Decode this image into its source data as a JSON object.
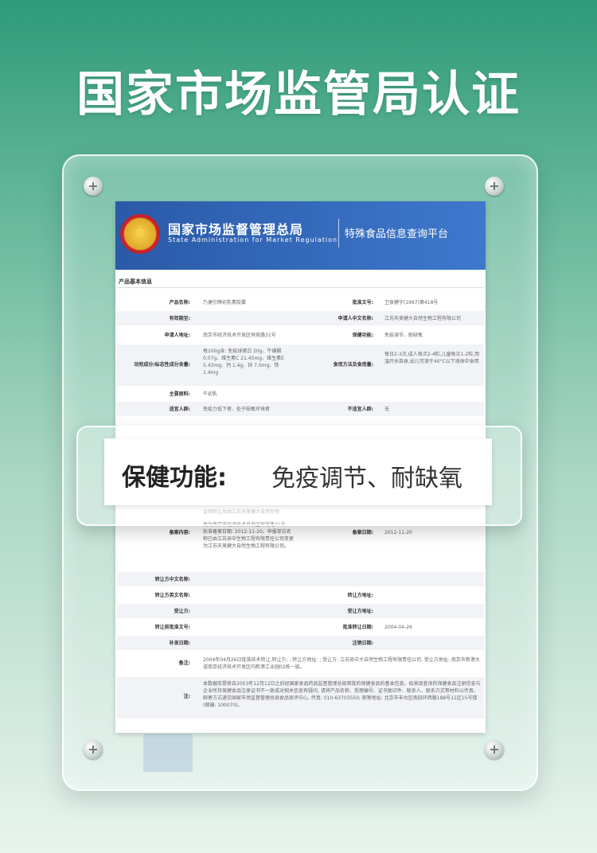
{
  "headline": "国家市场监管局认证",
  "doc": {
    "org_cn": "国家市场监督管理总局",
    "org_en": "State Administration for Market Regulation",
    "platform": "特殊食品信息查询平台",
    "section_title": "产品基本信息",
    "top_rows": [
      {
        "l1": "产品名称:",
        "v1": "乃捷尔牌初乳素胶囊",
        "l2": "批准文号:",
        "v2": "卫食健字(1997)第418号"
      },
      {
        "l1": "有效期至:",
        "v1": "",
        "l2": "申请人中文名称:",
        "v2": "江苏天美健大自然生物工程有限公司"
      },
      {
        "l1": "申请人地址:",
        "v1": "南京市经济技术开发区恒竞路31号",
        "l2": "保健功能:",
        "v2": "免疫调节、耐缺氧"
      },
      {
        "l1": "功效成分/标志性成分含量:",
        "v1": "每100g含: 免疫球蛋白 20g、牛磺酸 0.07g、维生素C 21.45mg、维生素E 5.43mg、钙 1.4g、锌 7.0mg、铁 1.4mg",
        "l2": "食用方法及食用量:",
        "v2": "每日2-3次,成人每次2-4粒,儿童每次1-2粒,用温开水吞食,幼儿可溶于40°C以下液体中食用"
      },
      {
        "l1": "主要原料:",
        "v1": "牛初乳",
        "l2": "",
        "v2": ""
      },
      {
        "l1": "适宜人群:",
        "v1": "免疫力低下者、处于缺氧环境者",
        "l2": "不适宜人群:",
        "v2": "无"
      }
    ],
    "partial_text": "证明转让后由江苏天美健大自然生物",
    "bottom_rows": [
      {
        "l1": "备案内容:",
        "v1": "更为南京市经济技术开发区恒竞路31号。 狄准备案日期: 2012-11-20。申报单位名称已由江苏吴中生物工程有限责任公司变更为江苏天美健大自然生物工程有限公司。",
        "l2": "备案日期:",
        "v2": "2012-11-20"
      },
      {
        "l1": "转让方中文名称:",
        "v1": "",
        "l2": "",
        "v2": ""
      },
      {
        "l1": "转让方英文名称:",
        "v1": "",
        "l2": "转让方地址:",
        "v2": ""
      },
      {
        "l1": "受让方:",
        "v1": "",
        "l2": "受让方地址:",
        "v2": ""
      },
      {
        "l1": "转让前批准文号:",
        "v1": "",
        "l2": "批准转让日期:",
        "v2": "2004-04-26"
      },
      {
        "l1": "补发日期:",
        "v1": "",
        "l2": "注销日期:",
        "v2": ""
      },
      {
        "l1": "备注:",
        "v1": "2004年04月26日批准技术转让,转让方: ; 转让方地址: ; 受让方: 江苏吴中大自然生物工程有限责任公司, 受让方地址: 南京市新港大道南京经济技术开发区内新港工业园02栋一层。",
        "l2": "",
        "v2": ""
      },
      {
        "l1": "注:",
        "v1": "本数据库提供自2003年12月12日之后经国家食品药品监督管理总局审批的保健食品的基本信息。如发现查询的保健食品注册信息与企业所持保健食品注册证书不一致或对相关信息有疑问, 请将产品名称、受理编号、证书复印件、联系人、联系方式等材料以传真、邮寄方式递交国家市场监督管理总局食品审评中心, 传真: 010-63703550; 邮寄地址: 北京市丰台区南四环西路188号11区15号楼(邮编: 100070)。",
        "l2": "",
        "v2": ""
      }
    ]
  },
  "callout": {
    "label": "保健功能:",
    "value": "免疫调节、耐缺氧"
  }
}
